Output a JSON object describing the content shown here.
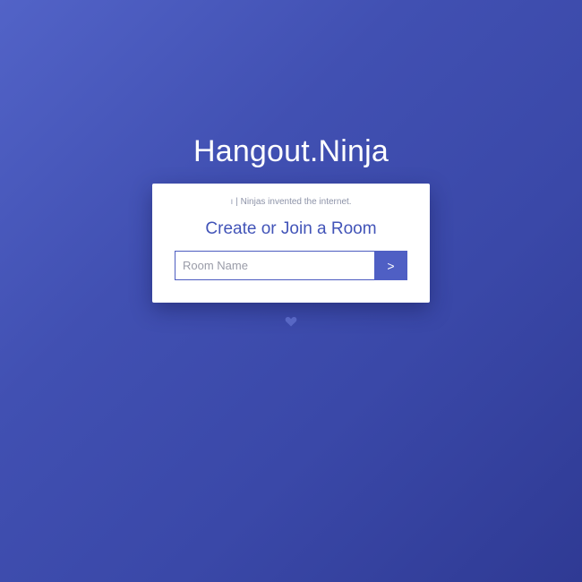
{
  "app": {
    "title": "Hangout.Ninja"
  },
  "card": {
    "tagline_mark": "ı",
    "tagline_text": "| Ninjas invented the internet.",
    "heading": "Create or Join a Room"
  },
  "form": {
    "room_placeholder": "Room Name",
    "room_value": "",
    "submit_label": ">"
  },
  "footer": {
    "icon": "heart-icon"
  },
  "colors": {
    "background_start": "#5263c7",
    "background_end": "#2f3a94",
    "accent": "#4f5fc4",
    "heading": "#4254b8",
    "heart": "#5867c4"
  }
}
